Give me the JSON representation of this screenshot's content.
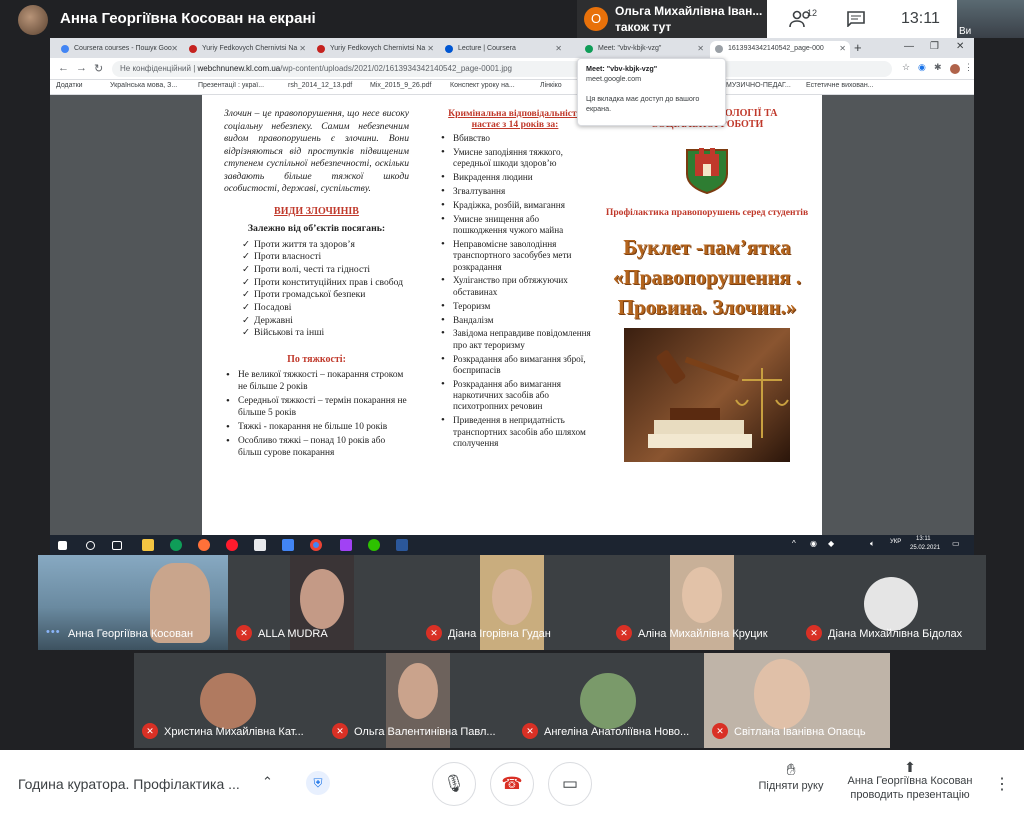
{
  "top": {
    "presenter_title": "Анна Георгіївна Косован на екрані",
    "notification_initial": "О",
    "notification_name": "Ольга Михайлівна Іван...",
    "notification_sub": "також тут",
    "people_count": "12",
    "clock": "13:11",
    "self_label": "Ви"
  },
  "browser": {
    "tabs": [
      {
        "label": "Coursera courses - Пошук Goo"
      },
      {
        "label": "Yuriy Fedkovych Chernivtsi Na"
      },
      {
        "label": "Yuriy Fedkovych Chernivtsi Na"
      },
      {
        "label": "Lecture | Coursera"
      },
      {
        "label": "Meet: \"vbv-kbjk-vzg\""
      },
      {
        "label": "1613934342140542_page-000"
      }
    ],
    "security_label": "Не конфіденційний",
    "url_host": "webchnunew.kl.com.ua",
    "url_path": "/wp-content/uploads/2021/02/1613934342140542_page-0001.jpg",
    "bookmarks": [
      "Додатки",
      "Українська мова, З...",
      "Презентації : украї...",
      "rsh_2014_12_13.pdf",
      "Mix_2015_9_26.pdf",
      "Конспект уроку на...",
      "Лінкіко",
      "МУЗИЧНО-ПЕДАГ...",
      "Естетичне вихован..."
    ],
    "popup": {
      "title": "Meet: \"vbv-kbjk-vzg\"",
      "host": "meet.google.com",
      "text": "Ця вкладка має доступ до вашого екрана."
    }
  },
  "booklet": {
    "intro": "Злочин – це правопорушення, що несе високу соціальну небезпеку. Самим небезпечним видом правопорушень є злочини. Вони відрізняються від проступків підвищеним ступенем суспільної небезпечності, оскільки завдають більше тяжкої шкоди особистості, державі, суспільству.",
    "types_heading": "ВИДИ ЗЛОЧИНІВ",
    "objects_heading": "Залежно від об’єктів посягань:",
    "objects": [
      "Проти життя та здоров’я",
      "Проти власності",
      "Проти волі, честі та гідності",
      "Проти конституційних прав і свобод",
      "Проти громадської безпеки",
      "Посадові",
      "Державні",
      "Військові та інші"
    ],
    "severity_heading": "По тяжкості:",
    "severity": [
      "Не великої тяжкості – покарання строком не більше 2 років",
      "Середньої тяжкості – термін покарання не більше 5 років",
      "Тяжкі - покарання не більше 10 років",
      "Особливо тяжкі – понад 10 років або більш сурове покарання"
    ],
    "criminal_heading": "Кримінальна відповідальність настає з 14 років за:",
    "crimes": [
      "Вбивство",
      "Умисне заподіяння тяжкого, середньої шкоди здоров’ю",
      "Викрадення людини",
      "Згвалтування",
      "Крадіжка, розбій, вимагання",
      "Умисне знищення або пошкодження чужого майна",
      "Неправомісне заволодіння транспортного засобубез мети розкрадання",
      "Хуліганство при обтяжуючих обставинах",
      "Тероризм",
      "Вандалізм",
      "Завідома неправдиве повідомлення про акт тероризму",
      "Розкрадання або вимагання зброї, боєприпасів",
      "Розкрадання або вимагання наркотичних засобів або психотропних речовин",
      "Приведення в непридатність транспортних засобів або шляхом сполучення"
    ],
    "institute": "...АГОГІКИ, ПСИХОЛОГІЇ ТА СОЦІАЛЬНОЇ РОБОТИ",
    "prophylaxis": "Профілактика правопорушень серед студентів",
    "big_title": "Буклет -пам’ятка «Правопорушення . Провина. Злочин.»"
  },
  "taskbar": {
    "lang": "УКР",
    "time": "13:11",
    "date": "25.02.2021"
  },
  "participants": [
    {
      "name": "Анна Георгіївна Косован",
      "muted": false,
      "bg": "#6a8aa0",
      "face": "#c9a58c"
    },
    {
      "name": "ALLA MUDRA",
      "muted": true,
      "bg": "#3a3436",
      "face": "#c49a86"
    },
    {
      "name": "Діана Ігорівна Гудан",
      "muted": true,
      "bg": "#c9ad7e",
      "face": "#d8b49a"
    },
    {
      "name": "Аліна Михайлівна Круцик",
      "muted": true,
      "bg": "#c8b098",
      "face": "#e2c2a8"
    },
    {
      "name": "Діана Михайлівна Бідолах",
      "muted": true,
      "bg": "#3c4043",
      "face": "#e5e5e5"
    },
    {
      "name": "Христина Михайлівна Кат...",
      "muted": true,
      "bg": "#3c4043",
      "face": "#b07a60"
    },
    {
      "name": "Ольга Валентинівна Павл...",
      "muted": true,
      "bg": "#6d625c",
      "face": "#caa38c"
    },
    {
      "name": "Ангеліна Анатоліївна Ново...",
      "muted": true,
      "bg": "#3c4043",
      "face": "#7a9a6a"
    },
    {
      "name": "Світлана Іванівна Опаєць",
      "muted": true,
      "bg": "#bfb4a8",
      "face": "#e0c0a8"
    }
  ],
  "bottom": {
    "meeting_title": "Година куратора. Профілактика ...",
    "raise_hand": "Підняти руку",
    "presenter_line1": "Анна Георгіївна Косован",
    "presenter_line2": "проводить презентацію"
  }
}
